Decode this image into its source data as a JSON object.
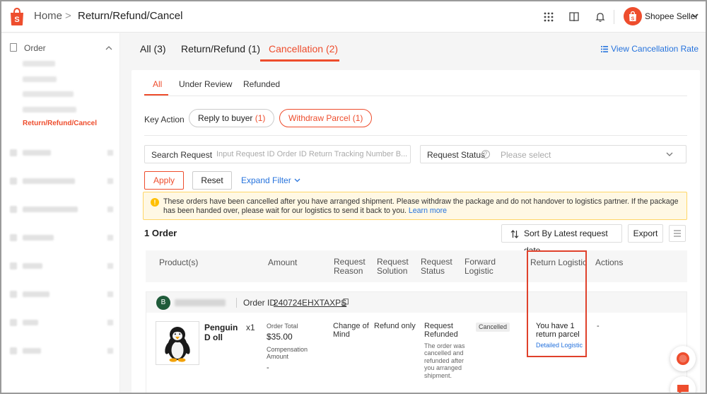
{
  "colors": {
    "accent": "#ee4d2d",
    "link": "#2673dd",
    "highlight_box": "#e0412b",
    "notice_bg": "#fff8e4"
  },
  "topbar": {
    "breadcrumb_home": "Home",
    "breadcrumb_separator": ">",
    "breadcrumb_current": "Return/Refund/Cancel",
    "icons": [
      "apps-grid-icon",
      "book-icon",
      "bell-icon"
    ],
    "seller_name": "Shopee Seller"
  },
  "sidebar": {
    "section_label": "Order",
    "active_item": "Return/Refund/Cancel"
  },
  "main_tabs": [
    {
      "label": "All (3)"
    },
    {
      "label": "Return/Refund (1)"
    },
    {
      "label": "Cancellation (2)"
    }
  ],
  "view_cancellation_rate": "View Cancellation Rate",
  "sub_tabs": [
    {
      "label": "All"
    },
    {
      "label": "Under Review"
    },
    {
      "label": "Refunded"
    }
  ],
  "key_action": {
    "label": "Key Action",
    "pills": [
      {
        "label": "Reply to buyer",
        "count": "(1)"
      },
      {
        "label": "Withdraw Parcel (1)"
      }
    ]
  },
  "search": {
    "label": "Search Request",
    "placeholder": "Input Request ID Order ID Return Tracking Number B..."
  },
  "request_status": {
    "label": "Request Status",
    "help": "?",
    "placeholder": "Please select"
  },
  "buttons": {
    "apply": "Apply",
    "reset": "Reset",
    "expand_filter": "Expand Filter"
  },
  "notice": {
    "icon": "!",
    "text": "These orders have been cancelled after you have arranged shipment. Please withdraw the package and do not handover to logistics partner. If the package has been handed over, please wait for our logistics to send it back to you.",
    "link": "Learn more"
  },
  "order_count": "1 Order",
  "sort_label": "Sort By Latest request date",
  "export_label": "Export",
  "table_headers": {
    "products": "Product(s)",
    "amount": "Amount",
    "request_reason": "Request\nReason",
    "request_solution": "Request\nSolution",
    "request_status": "Request\nStatus",
    "forward_logistic": "Forward\nLogistic",
    "return_logistic": "Return Logistic",
    "actions": "Actions"
  },
  "order": {
    "buyer_initial": "B",
    "order_id_label": "Order ID",
    "order_id": "240724EHXTAXPS",
    "product_name": "Penguin D oll",
    "quantity": "x1",
    "order_total_label": "Order Total",
    "order_total": "$35.00",
    "compensation_label": "Compensation Amount",
    "compensation_value": "-",
    "request_reason": "Change of Mind",
    "request_solution": "Refund only",
    "request_status": "Request Refunded",
    "request_status_note": "The order was cancelled and refunded after you arranged shipment.",
    "forward_logistic": "Cancelled",
    "return_logistic": "You have 1 return parcel",
    "return_logistic_link": "Detailed Logistic",
    "actions": "-"
  }
}
